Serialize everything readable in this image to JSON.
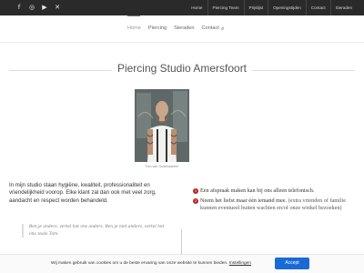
{
  "social": {
    "icons": [
      "facebook-icon",
      "instagram-icon",
      "youtube-icon",
      "x-icon"
    ],
    "glyphs": [
      "f",
      "◎",
      "▶",
      "✕"
    ]
  },
  "topnav": {
    "items": [
      "Home",
      "Piercing Team",
      "Prijslijst",
      "Openingstijden",
      "Contact",
      "Sieraden"
    ]
  },
  "mainnav": {
    "items": [
      "Home",
      "Piercing",
      "Sieraden",
      "Contact"
    ],
    "search_glyph": "⌕"
  },
  "page": {
    "title": "Piercing Studio Amersfoort",
    "photo_caption": "Tom van Oudenaarden",
    "intro": "In mijn studio staan hygiëne, kwaliteit, professionaliteit en vriendelijkheid voorop. Elke klant zal dan ook met veel zorg, aandacht en respect worden behandeld.",
    "quote": "Ben je anders, vertel het ons anders. Ben je niet anders, vertel het ons zoals Tom."
  },
  "bullets": [
    {
      "num": "1",
      "text": "Een afspraak maken kan bij ons alleen telefonisch.",
      "sub": ""
    },
    {
      "num": "2",
      "text": "Neem het liefst maar één iemand mee.",
      "sub": "(extra vrienden of familie kunnen eventueel buiten wachten en/of onze winkel bezoeken)"
    }
  ],
  "cookie": {
    "text": "Wij maken gebruik van cookies om u de beste ervaring van onze website te kunnen bieden.",
    "link": "Instellingen",
    "accept_label": "Accept"
  },
  "colors": {
    "topbar": "#2a2a2a",
    "bullet_red": "#b5281e",
    "accept_blue": "#1a6ad6"
  }
}
